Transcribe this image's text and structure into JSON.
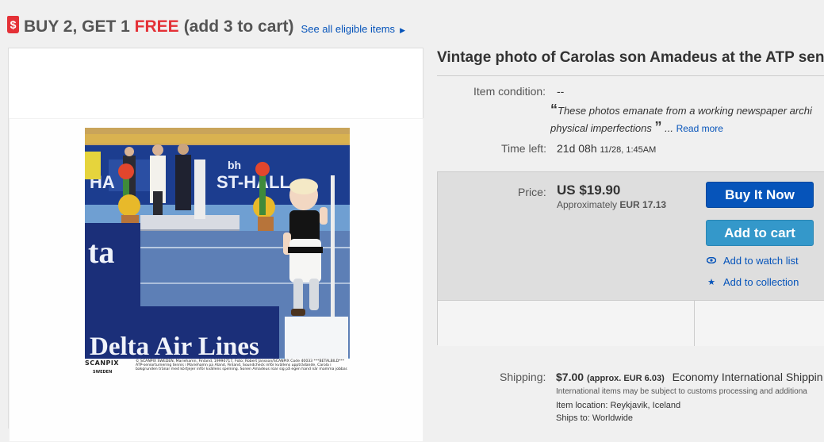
{
  "promo": {
    "main": "BUY 2, GET 1",
    "free": "FREE",
    "sub": "(add 3 to cart)",
    "link": "See all eligible items",
    "tag_icon": "$"
  },
  "photo_caption": {
    "logo": "SCANPIX",
    "logo_sub": "SWEDEN",
    "text": "© SCANPIX SWEDEN, Mariehamn, Finland, 19990717, Foto: Robert Jansson/SCANPIX Code 40033 ***BETALBILD*** ATP-seniorturnering tennis i Mariehamn pa Aland, Finland. Soundcheck inför kvällens uppträdande. Carola i bakgrunden tränar med körtjejer inför kvällens spelning. Sonen Amadeus roar sig på egen hand när mamma jobbar.",
    "sign_text": "Delta Air Lines",
    "sign_small": "ta",
    "hall_text": "ST-HALL",
    "hall_top": "bh",
    "hall_left": "HA"
  },
  "item": {
    "title": "Vintage photo of Carolas son Amadeus at the ATP seni",
    "condition_label": "Item condition:",
    "condition_value": "--",
    "quote_line1": "These photos emanate from a working newspaper archi",
    "quote_line2": "physical imperfections",
    "read_more": "Read more",
    "time_label": "Time left:",
    "time_value": "21d 08h",
    "time_detail": "11/28, 1:45AM"
  },
  "buy": {
    "price_label": "Price:",
    "price": "US $19.90",
    "approx_prefix": "Approximately",
    "approx_value": "EUR 17.13",
    "buy_now": "Buy It Now",
    "add_to_cart": "Add to cart",
    "watch": "Add to watch list",
    "collection": "Add to collection"
  },
  "shipping": {
    "label": "Shipping:",
    "price": "$7.00",
    "approx": "(approx. EUR 6.03)",
    "service": "Economy International Shippin",
    "note": "International items may be subject to customs processing and additiona",
    "location_label": "Item location:",
    "location": "Reykjavik, Iceland",
    "cut": "Ships to: Worldwide"
  },
  "colors": {
    "accent_blue": "#0654ba",
    "cart_blue": "#3498ca",
    "promo_red": "#e43137"
  },
  "icons": {
    "watch": "eye-icon",
    "collection": "star-icon",
    "promo": "price-tag-icon"
  }
}
